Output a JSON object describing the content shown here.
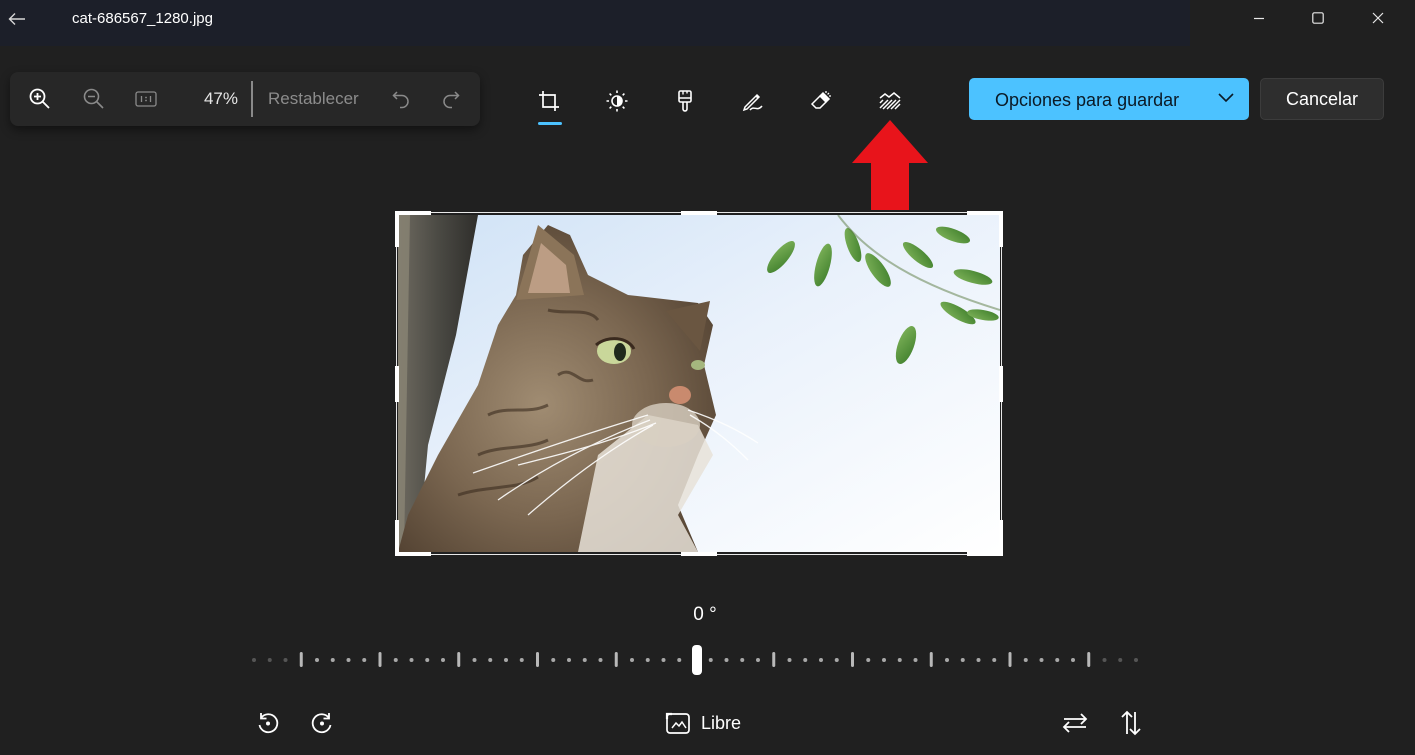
{
  "window": {
    "title": "cat-686567_1280.jpg",
    "back_icon": "arrow-left-icon",
    "controls": [
      "minimize-icon",
      "maximize-icon",
      "close-icon"
    ]
  },
  "zoom_toolbar": {
    "zoom_percent": "47%",
    "reset_label": "Restablecer",
    "icons": [
      "zoom-in-icon",
      "zoom-out-icon",
      "actual-size-icon",
      "undo-icon",
      "redo-icon"
    ]
  },
  "tools": {
    "active": "crop",
    "items": [
      "crop-icon",
      "adjustment-icon",
      "filter-icon",
      "markup-icon",
      "erase-icon",
      "background-blur-icon"
    ]
  },
  "actions": {
    "save_label": "Opciones para guardar",
    "cancel_label": "Cancelar"
  },
  "crop": {
    "angle_label": "0 °",
    "aspect_label": "Libre",
    "icons": [
      "rotate-left-icon",
      "rotate-right-icon",
      "aspect-ratio-icon",
      "flip-horizontal-icon",
      "flip-vertical-icon"
    ]
  },
  "colors": {
    "accent": "#4cc2ff",
    "background": "#202020",
    "annotation_arrow": "#e8141b"
  }
}
